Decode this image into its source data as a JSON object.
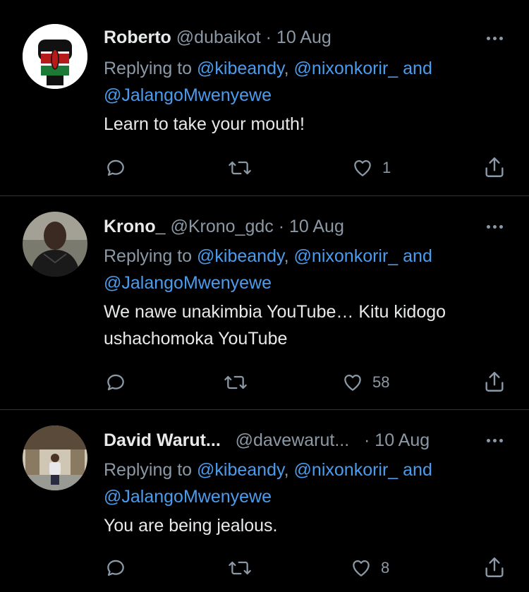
{
  "tweets": [
    {
      "name": "Roberto",
      "handle": "@dubaikot",
      "dot": "·",
      "time": "10 Aug",
      "replying_prefix": "Replying to ",
      "mention1": "@kibeandy",
      "comma": ", ",
      "mention2": "@nixonkorir_",
      "and": " and",
      "mention3": "@JalangoMwenyewe",
      "text": "Learn to take your mouth!",
      "likes": "1"
    },
    {
      "name": "Krono_",
      "handle": "@Krono_gdc",
      "dot": "·",
      "time": "10 Aug",
      "replying_prefix": "Replying to ",
      "mention1": "@kibeandy",
      "comma": ", ",
      "mention2": "@nixonkorir_",
      "and": " and",
      "mention3": "@JalangoMwenyewe",
      "text_line1": "We nawe unakimbia YouTube… Kitu kidogo",
      "text_line2": "ushachomoka YouTube",
      "likes": "58"
    },
    {
      "name": "David Warut...",
      "handle": "@davewarut...",
      "dot": "·",
      "time": "10 Aug",
      "replying_prefix": "Replying to ",
      "mention1": "@kibeandy",
      "comma": ", ",
      "mention2": "@nixonkorir_",
      "and": " and",
      "mention3": "@JalangoMwenyewe",
      "text": "You are being jealous.",
      "likes": "8"
    }
  ],
  "icons": {
    "reply": "reply-icon",
    "retweet": "retweet-icon",
    "like": "heart-icon",
    "share": "share-icon",
    "more": "more-icon"
  },
  "colors": {
    "background": "#000000",
    "primary_text": "#e7e9ea",
    "secondary_text": "#8b98a5",
    "mention": "#4b9ced",
    "divider": "#2f3336"
  }
}
